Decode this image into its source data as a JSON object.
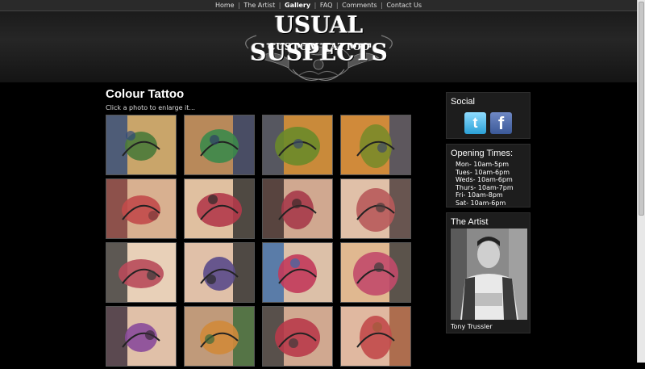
{
  "nav": {
    "items": [
      {
        "label": "Home",
        "active": false
      },
      {
        "label": "The Artist",
        "active": false
      },
      {
        "label": "Gallery",
        "active": true
      },
      {
        "label": "FAQ",
        "active": false
      },
      {
        "label": "Comments",
        "active": false
      },
      {
        "label": "Contact Us",
        "active": false
      }
    ],
    "separator": "|"
  },
  "header": {
    "logo_title": "USUAL SUSPECTS",
    "logo_subtitle": "CUSTOM TATTOO"
  },
  "main": {
    "title": "Colour Tattoo",
    "subtitle": "Click a photo to enlarge it...",
    "photo_count": 16,
    "visible_rows": 4,
    "columns": 4
  },
  "sidebar": {
    "social": {
      "title": "Social",
      "icons": [
        "twitter-icon",
        "facebook-icon"
      ]
    },
    "hours": {
      "title": "Opening Times:",
      "lines": [
        "Mon- 10am-5pm",
        "Tues- 10am-6pm",
        "Weds- 10am-6pm",
        "Thurs- 10am-7pm",
        "Fri- 10am-8pm",
        "Sat- 10am-6pm"
      ]
    },
    "artist": {
      "title": "The Artist",
      "name": "Tony Trussler"
    }
  },
  "colors": {
    "background": "#000000",
    "nav_bar": "#2a2a2a",
    "panel": "#1d1d1d",
    "text": "#ffffff",
    "twitter": "#2ba0d6",
    "facebook": "#3b5998"
  }
}
